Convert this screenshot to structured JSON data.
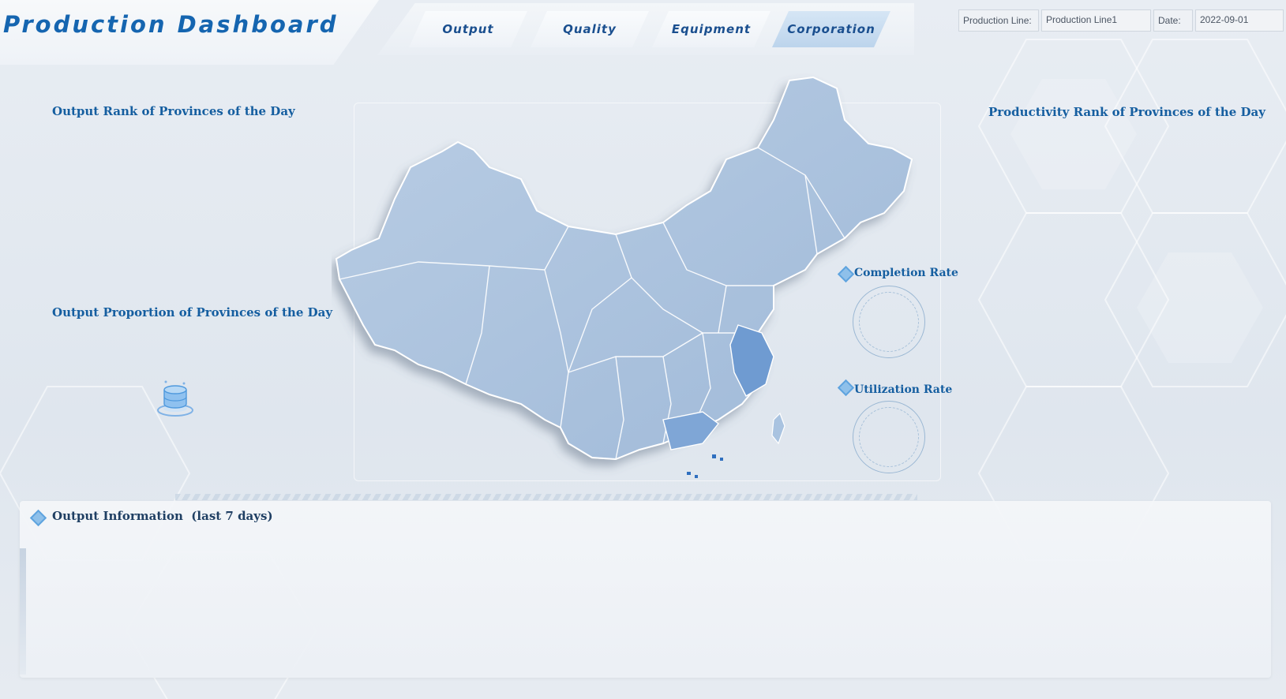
{
  "header": {
    "title": "Production Dashboard",
    "tabs": [
      {
        "label": "Output"
      },
      {
        "label": "Quality"
      },
      {
        "label": "Equipment"
      },
      {
        "label": "Corporation",
        "active": true
      }
    ],
    "filters": {
      "production_line_label": "Production Line:",
      "production_line_value": "Production Line1",
      "date_label": "Date:",
      "date_value": "2022-09-01"
    }
  },
  "panels": {
    "output_rank": "Output Rank of Provinces of the Day",
    "output_proportion": "Output Proportion of Provinces of the Day",
    "productivity_rank": "Productivity Rank of Provinces of the Day",
    "completion_rate": "Completion Rate",
    "utilization_rate": "Utilization Rate",
    "output_info": "Output Information  (last 7 days)"
  },
  "colors": {
    "title": "#1565b0",
    "heading": "#155ea0",
    "map_fill": "#a9c3e0",
    "map_highlight": "#6f9bd1"
  },
  "icons": [
    "diamond-icon",
    "database-icon"
  ]
}
